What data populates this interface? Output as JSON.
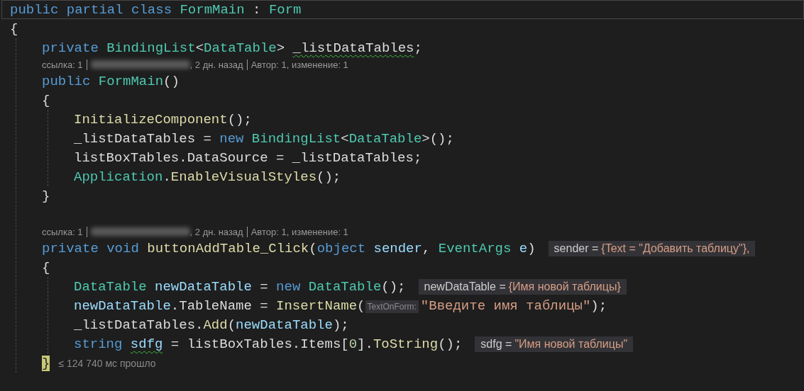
{
  "code_lines": [
    {
      "kind": "code",
      "highlighted": true,
      "tokens": [
        {
          "kind": "keyword",
          "text": "public partial class "
        },
        {
          "kind": "type",
          "text": "FormMain"
        },
        {
          "kind": "plain",
          "text": " : "
        },
        {
          "kind": "type",
          "text": "Form"
        }
      ]
    },
    {
      "kind": "code",
      "tokens": [
        {
          "kind": "plain",
          "text": "{"
        }
      ]
    },
    {
      "kind": "block",
      "children": [
        {
          "kind": "code",
          "tokens": [
            {
              "kind": "keyword",
              "text": "private "
            },
            {
              "kind": "type",
              "text": "BindingList"
            },
            {
              "kind": "plain",
              "text": "<"
            },
            {
              "kind": "type",
              "text": "DataTable"
            },
            {
              "kind": "plain",
              "text": "> "
            },
            {
              "kind": "plain",
              "text": "_listDataTables",
              "squiggle": true
            },
            {
              "kind": "plain",
              "text": ";"
            }
          ]
        },
        {
          "kind": "codelens",
          "references": "ссылка: 1",
          "date": ", 2 дн. назад",
          "authors": "Автор: 1, изменение: 1"
        },
        {
          "kind": "code",
          "tokens": [
            {
              "kind": "keyword",
              "text": "public "
            },
            {
              "kind": "type",
              "text": "FormMain"
            },
            {
              "kind": "plain",
              "text": "()"
            }
          ]
        },
        {
          "kind": "code",
          "tokens": [
            {
              "kind": "plain",
              "text": "{"
            }
          ]
        },
        {
          "kind": "block",
          "children": [
            {
              "kind": "code",
              "tokens": [
                {
                  "kind": "method",
                  "text": "InitializeComponent"
                },
                {
                  "kind": "plain",
                  "text": "();"
                }
              ]
            },
            {
              "kind": "code",
              "tokens": [
                {
                  "kind": "plain",
                  "text": "_listDataTables = "
                },
                {
                  "kind": "keyword",
                  "text": "new "
                },
                {
                  "kind": "type",
                  "text": "BindingList"
                },
                {
                  "kind": "plain",
                  "text": "<"
                },
                {
                  "kind": "type",
                  "text": "DataTable"
                },
                {
                  "kind": "plain",
                  "text": ">();"
                }
              ]
            },
            {
              "kind": "code",
              "tokens": [
                {
                  "kind": "plain",
                  "text": "listBoxTables.DataSource = _listDataTables;"
                }
              ]
            },
            {
              "kind": "code",
              "tokens": [
                {
                  "kind": "type",
                  "text": "Application"
                },
                {
                  "kind": "plain",
                  "text": "."
                },
                {
                  "kind": "method",
                  "text": "EnableVisualStyles"
                },
                {
                  "kind": "plain",
                  "text": "();"
                }
              ]
            }
          ]
        },
        {
          "kind": "code",
          "tokens": [
            {
              "kind": "plain",
              "text": "}"
            }
          ]
        },
        {
          "kind": "blank"
        },
        {
          "kind": "codelens",
          "references": "ссылка: 1",
          "date": ", 2 дн. назад",
          "authors": "Автор: 1, изменение: 1"
        },
        {
          "kind": "code",
          "tokens": [
            {
              "kind": "keyword",
              "text": "private void "
            },
            {
              "kind": "method",
              "text": "buttonAddTable_Click"
            },
            {
              "kind": "plain",
              "text": "("
            },
            {
              "kind": "keyword",
              "text": "object "
            },
            {
              "kind": "variable",
              "text": "sender"
            },
            {
              "kind": "plain",
              "text": ", "
            },
            {
              "kind": "type",
              "text": "EventArgs "
            },
            {
              "kind": "variable",
              "text": "e"
            },
            {
              "kind": "plain",
              "text": ")"
            }
          ],
          "datatip": {
            "name": "sender =",
            "value": "{Text = \"Добавить таблицу\"},"
          }
        },
        {
          "kind": "code",
          "tokens": [
            {
              "kind": "plain",
              "text": "{"
            }
          ]
        },
        {
          "kind": "block",
          "children": [
            {
              "kind": "code",
              "tokens": [
                {
                  "kind": "type",
                  "text": "DataTable "
                },
                {
                  "kind": "variable",
                  "text": "newDataTable"
                },
                {
                  "kind": "plain",
                  "text": " = "
                },
                {
                  "kind": "keyword",
                  "text": "new "
                },
                {
                  "kind": "type",
                  "text": "DataTable"
                },
                {
                  "kind": "plain",
                  "text": "();"
                }
              ],
              "datatip": {
                "name": "newDataTable =",
                "value": "{Имя новой таблицы}"
              }
            },
            {
              "kind": "code",
              "tokens": [
                {
                  "kind": "variable",
                  "text": "newDataTable"
                },
                {
                  "kind": "plain",
                  "text": ".TableName = "
                },
                {
                  "kind": "method",
                  "text": "InsertName"
                },
                {
                  "kind": "plain",
                  "text": "("
                },
                {
                  "kind": "hint",
                  "text": "TextOnForm:"
                },
                {
                  "kind": "string",
                  "text": "\"Введите имя таблицы\""
                },
                {
                  "kind": "plain",
                  "text": ");"
                }
              ]
            },
            {
              "kind": "code",
              "tokens": [
                {
                  "kind": "plain",
                  "text": "_listDataTables."
                },
                {
                  "kind": "method",
                  "text": "Add"
                },
                {
                  "kind": "plain",
                  "text": "("
                },
                {
                  "kind": "variable",
                  "text": "newDataTable"
                },
                {
                  "kind": "plain",
                  "text": ");"
                }
              ]
            },
            {
              "kind": "code",
              "tokens": [
                {
                  "kind": "keyword",
                  "text": "string "
                },
                {
                  "kind": "variable",
                  "text": "sdfg",
                  "squiggle": true
                },
                {
                  "kind": "plain",
                  "text": " = listBoxTables.Items["
                },
                {
                  "kind": "number",
                  "text": "0"
                },
                {
                  "kind": "plain",
                  "text": "]."
                },
                {
                  "kind": "method",
                  "text": "ToString"
                },
                {
                  "kind": "plain",
                  "text": "();"
                }
              ],
              "datatip": {
                "name": "sdfg =",
                "value": "\"Имя новой таблицы\""
              }
            }
          ]
        },
        {
          "kind": "code",
          "tokens": [
            {
              "kind": "plain",
              "text": "}",
              "matched": true
            }
          ],
          "perf_tip": "≤ 124 740 мс прошло"
        }
      ]
    }
  ]
}
